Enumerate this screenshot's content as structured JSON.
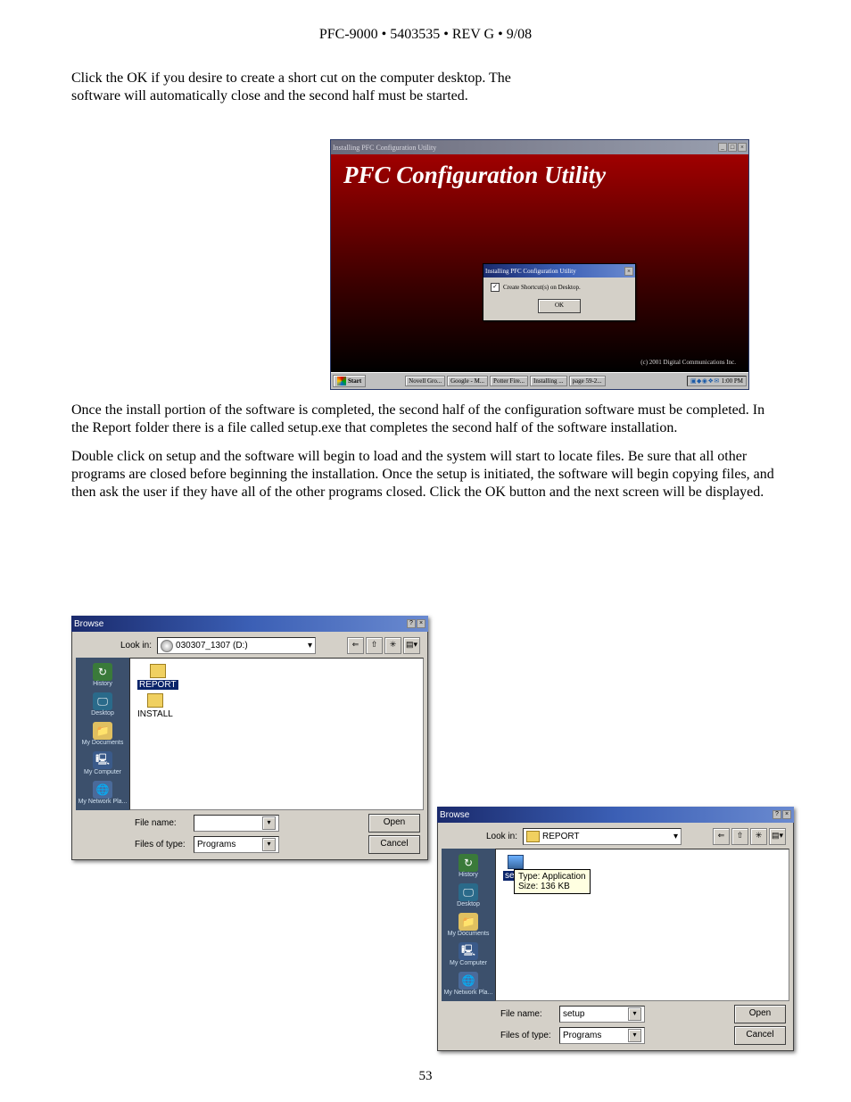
{
  "doc_header": "PFC-9000 • 5403535 • REV G • 9/08",
  "page_number": "53",
  "para1": "Click the OK if you desire to create a short cut on the computer desktop. The software will automatically close and the second half must be started.",
  "para2": "Once the install portion of the software is completed, the second half of the configuration software must be completed. In the Report folder there is a file called setup.exe that completes the second half of the software installation.",
  "para3": "Double click on setup and the software will begin to load and the system will start to locate files. Be sure that all other programs are closed before beginning the installation. Once the setup is initiated, the software will begin copying files, and then ask the user if they have all of the other programs closed. Click the OK button and the next screen will be displayed.",
  "installer": {
    "window_title": "Installing PFC Configuration Utility",
    "heading": "PFC Configuration Utility",
    "dialog_title": "Installing PFC Configuration Utility",
    "checkbox_label": "Create Shortcut(s) on Desktop.",
    "ok_label": "OK",
    "copyright": "(c) 2001 Digital Communications Inc.",
    "taskbar": {
      "start": "Start",
      "items": [
        "Novell Gro...",
        "Google - M...",
        "Potter Fire...",
        "Installing ...",
        "page 59-2..."
      ],
      "time": "1:00 PM"
    }
  },
  "places": {
    "history": "History",
    "desktop": "Desktop",
    "mydoc": "My Documents",
    "mycomp": "My Computer",
    "mynet": "My Network Pla..."
  },
  "browse1": {
    "title": "Browse",
    "lookin_label": "Look in:",
    "lookin_value": "030307_1307 (D:)",
    "files": [
      "REPORT",
      "INSTALL"
    ],
    "filename_label": "File name:",
    "filename_value": "",
    "filetype_label": "Files of type:",
    "filetype_value": "Programs",
    "open": "Open",
    "cancel": "Cancel"
  },
  "browse2": {
    "title": "Browse",
    "lookin_label": "Look in:",
    "lookin_value": "REPORT",
    "file": "setup",
    "tooltip": "Type: Application\nSize: 136 KB",
    "filename_label": "File name:",
    "filename_value": "setup",
    "filetype_label": "Files of type:",
    "filetype_value": "Programs",
    "open": "Open",
    "cancel": "Cancel"
  }
}
